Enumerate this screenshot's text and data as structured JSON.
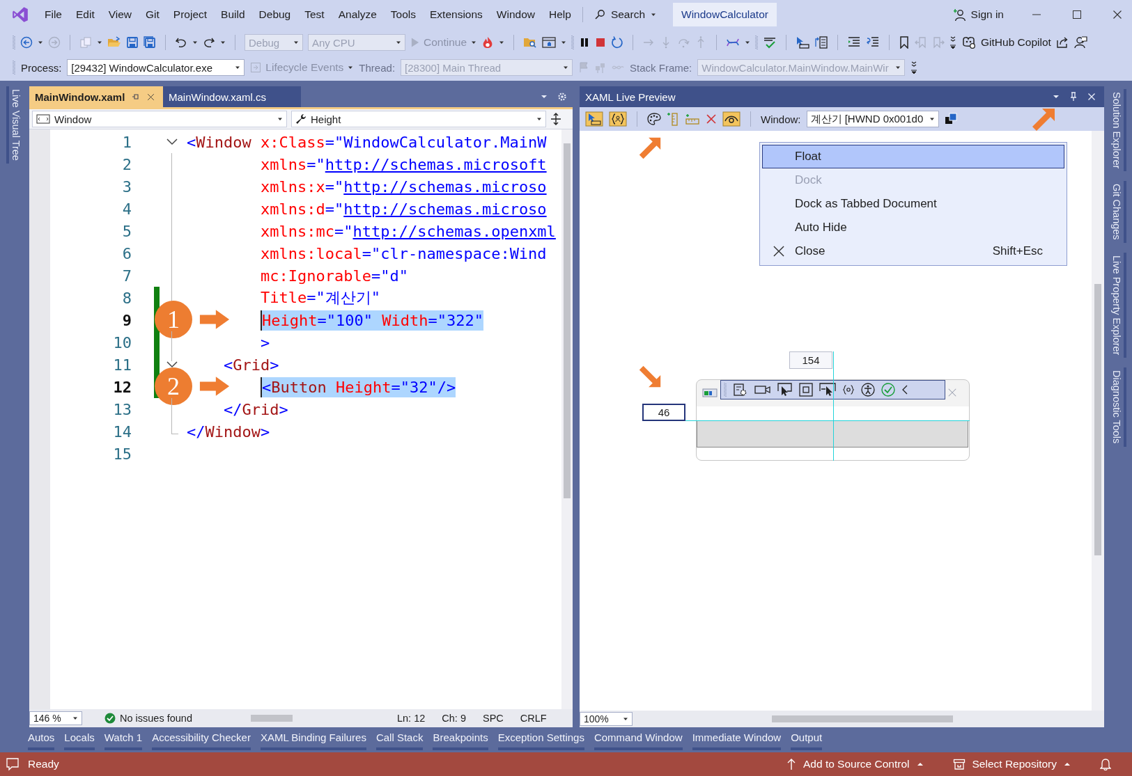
{
  "menu_bar": {
    "items": [
      "File",
      "Edit",
      "View",
      "Git",
      "Project",
      "Build",
      "Debug",
      "Test",
      "Analyze",
      "Tools",
      "Extensions",
      "Window",
      "Help"
    ],
    "search": "Search",
    "solution": "WindowCalculator",
    "sign_in": "Sign in"
  },
  "toolbar": {
    "configuration": "Debug",
    "platform": "Any CPU",
    "continue": "Continue",
    "copilot": "GitHub Copilot"
  },
  "debug_location": {
    "process_label": "Process:",
    "process": "[29432] WindowCalculator.exe",
    "lifecycle": "Lifecycle Events",
    "thread_label": "Thread:",
    "thread": "[28300] Main Thread",
    "stack_label": "Stack Frame:",
    "stack_frame": "WindowCalculator.MainWindow.MainWir"
  },
  "left_rail": [
    "Live Visual Tree"
  ],
  "editor": {
    "tabs": [
      {
        "label": "MainWindow.xaml",
        "selected": true
      },
      {
        "label": "MainWindow.xaml.cs",
        "selected": false
      }
    ],
    "nav": [
      "Window",
      "Height"
    ],
    "lines": [
      {
        "number": "1",
        "kind": "element",
        "selected": false,
        "changed": false,
        "fold": true,
        "tokens": [
          {
            "text": "<",
            "kind": "tag"
          },
          {
            "text": "Window",
            "kind": "name"
          },
          {
            "text": " x:Class",
            "kind": "attr"
          },
          {
            "text": "=\"WindowCalculator.MainW",
            "kind": "value"
          }
        ]
      },
      {
        "number": "2",
        "kind": "attribute",
        "selected": false,
        "changed": false,
        "fold": false,
        "tokens": [
          {
            "text": "xmlns",
            "kind": "attr"
          },
          {
            "text": "=\"",
            "kind": "value"
          },
          {
            "text": "http://schemas.microsoft",
            "kind": "link"
          }
        ]
      },
      {
        "number": "3",
        "kind": "attribute",
        "selected": false,
        "changed": false,
        "fold": false,
        "tokens": [
          {
            "text": "xmlns:x",
            "kind": "attr"
          },
          {
            "text": "=\"",
            "kind": "value"
          },
          {
            "text": "http://schemas.microso",
            "kind": "link"
          }
        ]
      },
      {
        "number": "4",
        "kind": "attribute",
        "selected": false,
        "changed": false,
        "fold": false,
        "tokens": [
          {
            "text": "xmlns:d",
            "kind": "attr"
          },
          {
            "text": "=\"",
            "kind": "value"
          },
          {
            "text": "http://schemas.microso",
            "kind": "link"
          }
        ]
      },
      {
        "number": "5",
        "kind": "attribute",
        "selected": false,
        "changed": false,
        "fold": false,
        "tokens": [
          {
            "text": "xmlns:mc",
            "kind": "attr"
          },
          {
            "text": "=\"",
            "kind": "value"
          },
          {
            "text": "http://schemas.openxml",
            "kind": "link"
          }
        ]
      },
      {
        "number": "6",
        "kind": "attribute",
        "selected": false,
        "changed": false,
        "fold": false,
        "tokens": [
          {
            "text": "xmlns:local",
            "kind": "attr"
          },
          {
            "text": "=\"clr-namespace:Wind",
            "kind": "value"
          }
        ]
      },
      {
        "number": "7",
        "kind": "attribute",
        "selected": false,
        "changed": false,
        "fold": false,
        "tokens": [
          {
            "text": "mc:Ignorable",
            "kind": "attr"
          },
          {
            "text": "=\"d\"",
            "kind": "value"
          }
        ]
      },
      {
        "number": "8",
        "kind": "attribute",
        "selected": false,
        "changed": true,
        "fold": false,
        "tokens": [
          {
            "text": "Title",
            "kind": "attr"
          },
          {
            "text": "=\"계산기\"",
            "kind": "value"
          }
        ]
      },
      {
        "number": "9",
        "kind": "attribute",
        "selected": true,
        "changed": true,
        "fold": false,
        "badge": "1",
        "tokens": [
          {
            "text": "Height",
            "kind": "attr"
          },
          {
            "text": "=\"100\" ",
            "kind": "value"
          },
          {
            "text": "Width",
            "kind": "attr"
          },
          {
            "text": "=\"322\"",
            "kind": "value"
          }
        ]
      },
      {
        "number": "10",
        "kind": "attribute",
        "selected": false,
        "changed": true,
        "fold": false,
        "tokens": [
          {
            "text": ">",
            "kind": "tag"
          }
        ]
      },
      {
        "number": "11",
        "kind": "child",
        "selected": false,
        "changed": true,
        "fold": true,
        "tokens": [
          {
            "text": "<",
            "kind": "tag"
          },
          {
            "text": "Grid",
            "kind": "name"
          },
          {
            "text": ">",
            "kind": "tag"
          }
        ]
      },
      {
        "number": "12",
        "kind": "attribute",
        "selected": true,
        "changed": true,
        "fold": false,
        "badge": "2",
        "tokens": [
          {
            "text": "<",
            "kind": "tag"
          },
          {
            "text": "Button",
            "kind": "name"
          },
          {
            "text": " Height",
            "kind": "attr"
          },
          {
            "text": "=\"32\"/>",
            "kind": "value"
          }
        ]
      },
      {
        "number": "13",
        "kind": "child",
        "selected": false,
        "changed": false,
        "fold": false,
        "tokens": [
          {
            "text": "</",
            "kind": "tag"
          },
          {
            "text": "Grid",
            "kind": "name"
          },
          {
            "text": ">",
            "kind": "tag"
          }
        ]
      },
      {
        "number": "14",
        "kind": "element",
        "selected": false,
        "changed": false,
        "fold": false,
        "tokens": [
          {
            "text": "</",
            "kind": "tag"
          },
          {
            "text": "Window",
            "kind": "name"
          },
          {
            "text": ">",
            "kind": "tag"
          }
        ]
      },
      {
        "number": "15",
        "kind": "element",
        "selected": false,
        "changed": false,
        "fold": false
      }
    ],
    "zoom": "146 %",
    "issues": "No issues found",
    "position": [
      "Ln: 12",
      "Ch: 9",
      "SPC",
      "CRLF"
    ]
  },
  "preview": {
    "title": "XAML Live Preview",
    "window_label": "Window:",
    "window": "계산기 [HWND 0x001d0",
    "menu": [
      {
        "label": "Float",
        "selected": true,
        "disabled": false,
        "kind": "plain"
      },
      {
        "label": "Dock",
        "selected": false,
        "disabled": true,
        "kind": "plain"
      },
      {
        "label": "Dock as Tabbed Document",
        "selected": false,
        "disabled": false,
        "kind": "plain"
      },
      {
        "label": "Auto Hide",
        "selected": false,
        "disabled": false,
        "kind": "plain"
      },
      {
        "label": "Close",
        "selected": false,
        "disabled": false,
        "kind": "close",
        "shortcut": "Shift+Esc"
      }
    ],
    "width_label": "154",
    "height_label": "46",
    "zoom": "100%"
  },
  "right_rail": [
    "Solution Explorer",
    "Git Changes",
    "Live Property Explorer",
    "Diagnostic Tools"
  ],
  "tool_tabs": [
    "Autos",
    "Locals",
    "Watch 1",
    "Accessibility Checker",
    "XAML Binding Failures",
    "Call Stack",
    "Breakpoints",
    "Exception Settings",
    "Command Window",
    "Immediate Window",
    "Output"
  ],
  "status_bar": {
    "ready": "Ready",
    "source_control": "Add to Source Control",
    "repository": "Select Repository"
  }
}
